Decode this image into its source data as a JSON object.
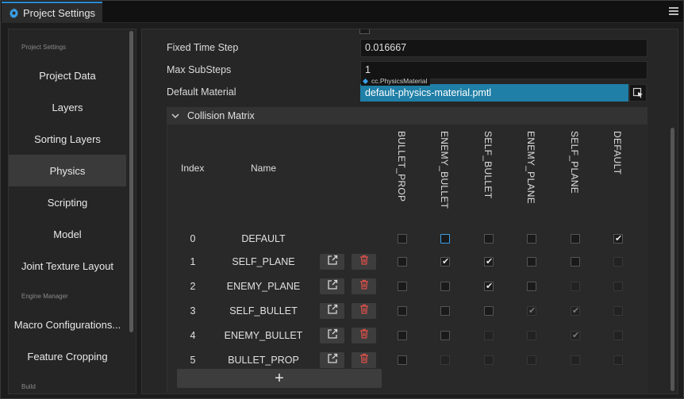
{
  "window": {
    "tab_title": "Project Settings"
  },
  "sidebar": {
    "groups": [
      {
        "heading": "Project Settings",
        "items": [
          {
            "label": "Project Data",
            "active": false
          },
          {
            "label": "Layers",
            "active": false
          },
          {
            "label": "Sorting Layers",
            "active": false
          },
          {
            "label": "Physics",
            "active": true
          },
          {
            "label": "Scripting",
            "active": false
          },
          {
            "label": "Model",
            "active": false
          },
          {
            "label": "Joint Texture Layout",
            "active": false
          }
        ]
      },
      {
        "heading": "Engine Manager",
        "items": [
          {
            "label": "Macro Configurations...",
            "active": false
          },
          {
            "label": "Feature Cropping",
            "active": false
          }
        ]
      },
      {
        "heading": "Build",
        "items": []
      }
    ]
  },
  "physics": {
    "fixed_time_step": {
      "label": "Fixed Time Step",
      "value": "0.016667"
    },
    "max_substeps": {
      "label": "Max SubSteps",
      "value": "1"
    },
    "default_material": {
      "label": "Default Material",
      "type": "cc.PhysicsMaterial",
      "value": "default-physics-material.pmtl"
    }
  },
  "collision_matrix": {
    "title": "Collision Matrix",
    "index_header": "Index",
    "name_header": "Name",
    "columns": [
      "BULLET_PROP",
      "ENEMY_BULLET",
      "SELF_BULLET",
      "ENEMY_PLANE",
      "SELF_PLANE",
      "DEFAULT"
    ],
    "rows": [
      {
        "index": "0",
        "name": "DEFAULT",
        "editable": false,
        "cells": [
          {
            "c": false,
            "e": true
          },
          {
            "c": false,
            "e": true,
            "f": true
          },
          {
            "c": false,
            "e": true
          },
          {
            "c": false,
            "e": true
          },
          {
            "c": false,
            "e": true
          },
          {
            "c": true,
            "e": true
          }
        ]
      },
      {
        "index": "1",
        "name": "SELF_PLANE",
        "editable": true,
        "cells": [
          {
            "c": false,
            "e": true
          },
          {
            "c": true,
            "e": true
          },
          {
            "c": true,
            "e": true
          },
          {
            "c": false,
            "e": true
          },
          {
            "c": false,
            "e": true
          },
          {
            "c": false,
            "e": false
          }
        ]
      },
      {
        "index": "2",
        "name": "ENEMY_PLANE",
        "editable": true,
        "cells": [
          {
            "c": false,
            "e": true
          },
          {
            "c": false,
            "e": true
          },
          {
            "c": true,
            "e": true
          },
          {
            "c": false,
            "e": true
          },
          {
            "c": false,
            "e": false
          },
          {
            "c": false,
            "e": false
          }
        ]
      },
      {
        "index": "3",
        "name": "SELF_BULLET",
        "editable": true,
        "cells": [
          {
            "c": false,
            "e": true
          },
          {
            "c": false,
            "e": true
          },
          {
            "c": false,
            "e": true
          },
          {
            "c": true,
            "e": false
          },
          {
            "c": true,
            "e": false
          },
          {
            "c": false,
            "e": false
          }
        ]
      },
      {
        "index": "4",
        "name": "ENEMY_BULLET",
        "editable": true,
        "cells": [
          {
            "c": false,
            "e": true
          },
          {
            "c": false,
            "e": true
          },
          {
            "c": false,
            "e": false
          },
          {
            "c": false,
            "e": false
          },
          {
            "c": true,
            "e": false
          },
          {
            "c": false,
            "e": false
          }
        ]
      },
      {
        "index": "5",
        "name": "BULLET_PROP",
        "editable": true,
        "cells": [
          {
            "c": false,
            "e": true
          },
          {
            "c": false,
            "e": false
          },
          {
            "c": false,
            "e": false
          },
          {
            "c": false,
            "e": false
          },
          {
            "c": false,
            "e": false
          },
          {
            "c": false,
            "e": false
          }
        ]
      }
    ],
    "add_label": "+"
  },
  "icons": {
    "edit": "edit-icon",
    "delete": "trash-icon",
    "settings": "gear-icon",
    "menu": "menu-icon",
    "pick": "asset-picker-icon"
  },
  "colors": {
    "accent": "#2a8cd1",
    "asset_bg": "#1f7fa6",
    "delete": "#e0504a"
  }
}
